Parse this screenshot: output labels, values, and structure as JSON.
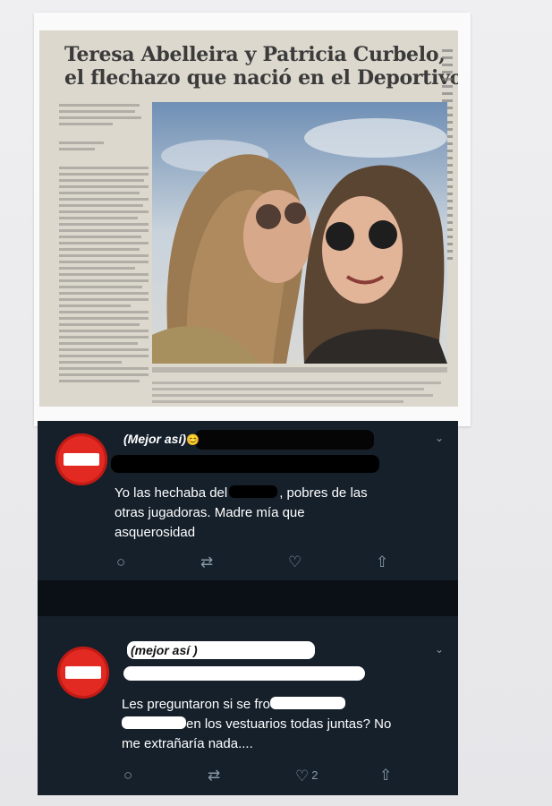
{
  "newspaper": {
    "headline_line1": "Teresa Abelleira y Patricia Curbelo,",
    "headline_line2": "el flechazo que nació en el Deportivo"
  },
  "tweets": [
    {
      "username": "(Mejor así)",
      "emoji": "😊",
      "text_part1": "Yo las hechaba del",
      "text_part2": ", pobres de las",
      "text_line2": "otras jugadoras. Madre mía que",
      "text_line3": "asquerosidad",
      "actions": {
        "reply": "○",
        "retweet": "⇄",
        "like": "♡",
        "share": "⇧",
        "like_count": ""
      }
    },
    {
      "username": "(mejor así )",
      "text_line1": "Les preguntaron si se fro",
      "text_line2": "en los vestuarios todas juntas? No",
      "text_line3": "me extrañaría nada....",
      "actions": {
        "reply": "○",
        "retweet": "⇄",
        "like": "♡",
        "share": "⇧",
        "like_count": "2"
      }
    }
  ],
  "colors": {
    "tweet_bg": "#15202b",
    "avatar_red": "#e22a22",
    "icon_gray": "#8899a6"
  }
}
